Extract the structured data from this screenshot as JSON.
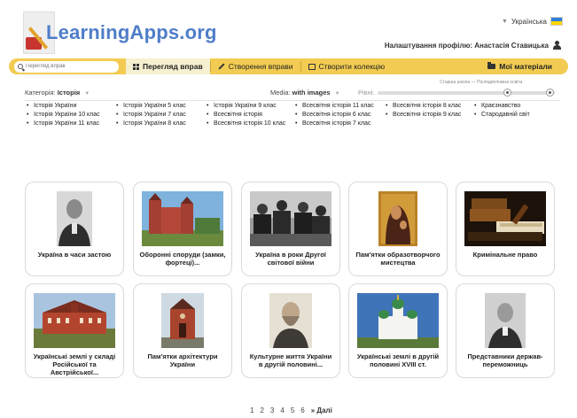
{
  "header": {
    "logo_text": "LearningApps.org",
    "language": "Українська",
    "profile_text": "Налаштування профілю: Анастасія Ставицька"
  },
  "nav": {
    "search_placeholder": "Перегляд вправ",
    "items": [
      {
        "label": "Перегляд вправ",
        "icon": "grid-icon",
        "active": true
      },
      {
        "label": "Створення вправи",
        "icon": "pencil-icon",
        "active": false
      },
      {
        "label": "Створити колекцію",
        "icon": "collection-icon",
        "active": false
      },
      {
        "label": "Мої матеріали",
        "icon": "folder-icon",
        "active": false
      }
    ]
  },
  "filters": {
    "category_label": "Категорія:",
    "category_value": "Історія",
    "media_label": "Media:",
    "media_value": "with images",
    "levels_label": "Рівні:",
    "levels_note": "Старша школа — Післядипломна освіта"
  },
  "categories": [
    [
      "Історія України",
      "Історія України 10 клас",
      "Історія України 11 клас"
    ],
    [
      "Історія України 5 клас",
      "Історія України 7 клас",
      "Історія України 8 клас"
    ],
    [
      "Історія України 9 клас",
      "Всесвітня історія",
      "Всесвітня історія 10 клас"
    ],
    [
      "Всесвітня історія 11 клас",
      "Всесвітня історія 6 клас",
      "Всесвітня історія 7 клас"
    ],
    [
      "Всесвітня історія 8 клас",
      "Всесвітня історія 9 клас"
    ],
    [
      "Краєзнавство",
      "Стародавній світ"
    ]
  ],
  "cards": [
    {
      "title": "Україна в часи застою",
      "image": "portrait-man-photo"
    },
    {
      "title": "Оборонні споруди (замки, фортеці)...",
      "image": "castle-photo"
    },
    {
      "title": "Україна в роки Другої світової війни",
      "image": "conference-photo"
    },
    {
      "title": "Пам'ятки образотворчого мистецтва",
      "image": "icon-painting"
    },
    {
      "title": "Кримінальне право",
      "image": "law-books-photo"
    },
    {
      "title": "Українські землі у складі Російської та Австрійської...",
      "image": "building-photo"
    },
    {
      "title": "Пам'ятки архітектури України",
      "image": "church-photo"
    },
    {
      "title": "Культурне життя України в другій половині...",
      "image": "portrait-bearded-man"
    },
    {
      "title": "Українські землі в другій половині XVIII ст.",
      "image": "cathedral-photo"
    },
    {
      "title": "Представники держав-переможниць",
      "image": "portrait-statesman"
    }
  ],
  "pager": {
    "pages": [
      "1",
      "2",
      "3",
      "4",
      "5",
      "6"
    ],
    "next_label": "» Далі"
  },
  "colors": {
    "nav_yellow": "#f2cc52",
    "logo_blue": "#4f7dc9"
  }
}
